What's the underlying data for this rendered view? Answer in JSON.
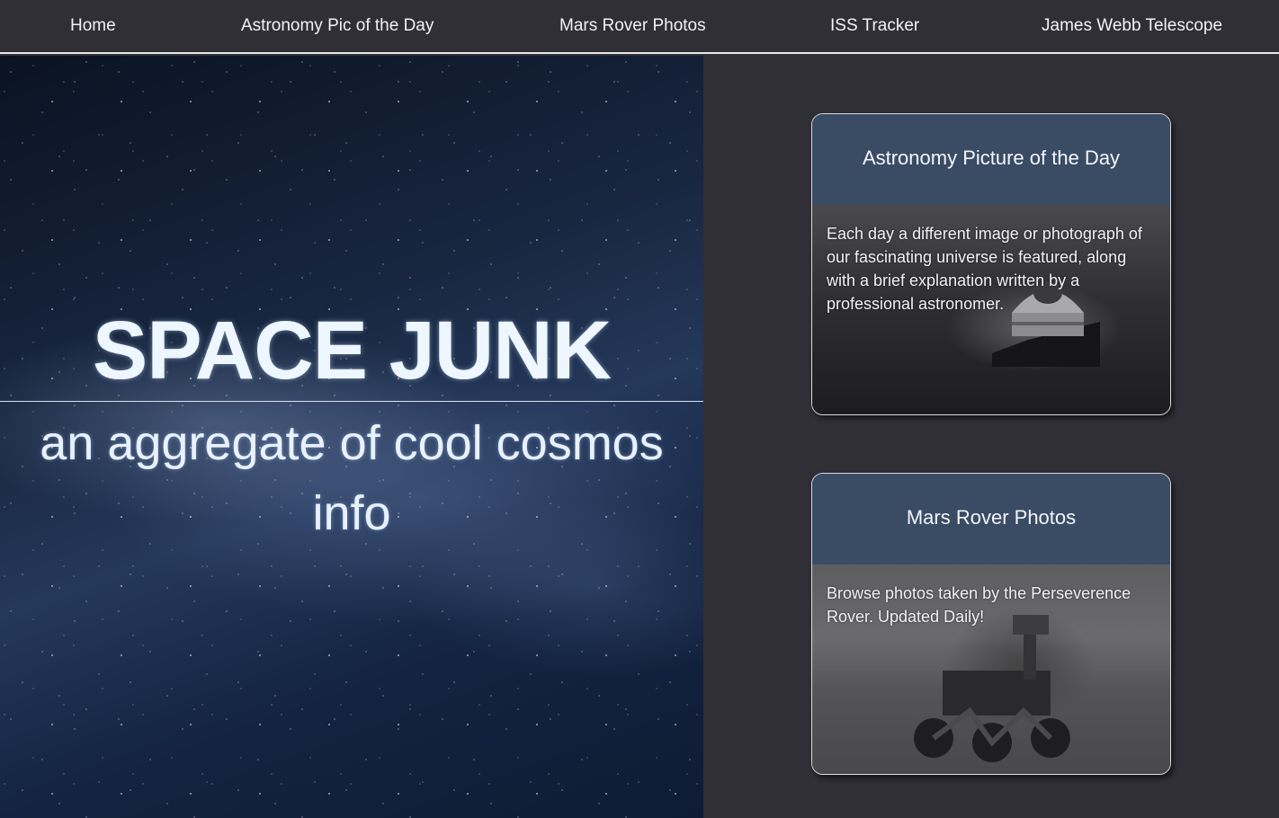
{
  "nav": {
    "items": [
      {
        "label": "Home"
      },
      {
        "label": "Astronomy Pic of the Day"
      },
      {
        "label": "Mars Rover Photos"
      },
      {
        "label": "ISS Tracker"
      },
      {
        "label": "James Webb Telescope"
      }
    ]
  },
  "hero": {
    "title": "SPACE JUNK",
    "subtitle_line1": "an aggregate of cool cosmos",
    "subtitle_line2": "info"
  },
  "cards": [
    {
      "title": "Astronomy Picture of the Day",
      "description": "Each day a different image or photograph of our fascinating universe is featured, along with a brief explanation written by a professional astronomer."
    },
    {
      "title": "Mars Rover Photos",
      "description": "Browse photos taken by the Perseverence Rover. Updated Daily!"
    }
  ],
  "colors": {
    "background": "#302f36",
    "card_header": "#3a4b64",
    "text": "#ffffff"
  }
}
